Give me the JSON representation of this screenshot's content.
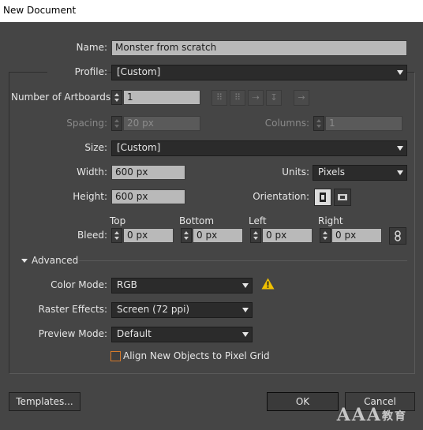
{
  "window": {
    "title": "New Document"
  },
  "fields": {
    "name": {
      "label": "Name:",
      "value": "Monster from scratch"
    },
    "profile": {
      "label": "Profile:",
      "value": "[Custom]"
    },
    "artboards": {
      "label": "Number of Artboards:",
      "value": "1"
    },
    "spacing": {
      "label": "Spacing:",
      "value": "20 px"
    },
    "columns": {
      "label": "Columns:",
      "value": "1"
    },
    "size": {
      "label": "Size:",
      "value": "[Custom]"
    },
    "width": {
      "label": "Width:",
      "value": "600 px"
    },
    "units": {
      "label": "Units:",
      "value": "Pixels"
    },
    "height": {
      "label": "Height:",
      "value": "600 px"
    },
    "orientation": {
      "label": "Orientation:"
    },
    "bleed": {
      "label": "Bleed:",
      "top": {
        "label": "Top",
        "value": "0 px"
      },
      "bottom": {
        "label": "Bottom",
        "value": "0 px"
      },
      "left": {
        "label": "Left",
        "value": "0 px"
      },
      "right": {
        "label": "Right",
        "value": "0 px"
      }
    }
  },
  "advanced": {
    "label": "Advanced",
    "color_mode": {
      "label": "Color Mode:",
      "value": "RGB"
    },
    "raster_effects": {
      "label": "Raster Effects:",
      "value": "Screen (72 ppi)"
    },
    "preview_mode": {
      "label": "Preview Mode:",
      "value": "Default"
    },
    "align_pixel_grid": {
      "label": "Align New Objects to Pixel Grid",
      "checked": false
    }
  },
  "buttons": {
    "templates": "Templates...",
    "ok": "OK",
    "cancel": "Cancel"
  },
  "watermark": {
    "latin": "AAA",
    "cn": "教育"
  },
  "colors": {
    "warning": "#f0c000",
    "checkbox_border": "#d67a2a"
  }
}
